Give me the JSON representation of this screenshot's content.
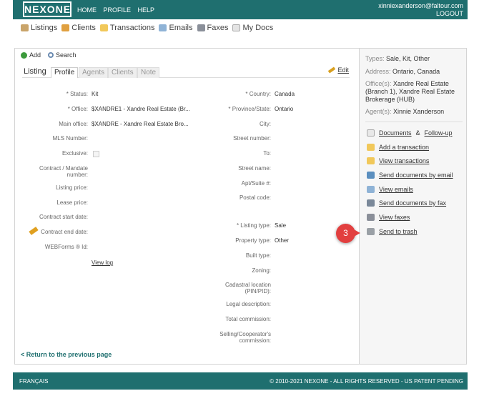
{
  "header": {
    "logo": "NEXONE",
    "nav": [
      "HOME",
      "PROFILE",
      "HELP"
    ],
    "user_email": "xinniexanderson@faltour.com",
    "logout": "LOGOUT"
  },
  "subnav": [
    "Listings",
    "Clients",
    "Transactions",
    "Emails",
    "Faxes",
    "My Docs"
  ],
  "actions": {
    "add": "Add",
    "search": "Search"
  },
  "tabs": {
    "title": "Listing",
    "items": [
      "Profile",
      "Agents",
      "Clients",
      "Note"
    ],
    "edit": "Edit"
  },
  "left_fields": {
    "status": {
      "label": "* Status:",
      "value": "Kit"
    },
    "office": {
      "label": "* Office:",
      "value": "$XANDRE1 - Xandre Real Estate (Br..."
    },
    "main_office": {
      "label": "Main office:",
      "value": "$XANDRE - Xandre Real Estate Bro..."
    },
    "mls": {
      "label": "MLS Number:"
    },
    "exclusive": {
      "label": "Exclusive:"
    },
    "contract": {
      "label": "Contract / Mandate number:"
    },
    "listing_price": {
      "label": "Listing price:"
    },
    "lease_price": {
      "label": "Lease price:"
    },
    "start_date": {
      "label": "Contract start date:"
    },
    "end_date": {
      "label": "Contract end date:"
    },
    "webforms": {
      "label": "WEBForms ® Id:"
    },
    "view_log": "View log"
  },
  "right_fields": {
    "country": {
      "label": "* Country:",
      "value": "Canada"
    },
    "province": {
      "label": "* Province/State:",
      "value": "Ontario"
    },
    "city": {
      "label": "City:"
    },
    "street_number": {
      "label": "Street number:"
    },
    "to": {
      "label": "To:"
    },
    "street_name": {
      "label": "Street name:"
    },
    "apt": {
      "label": "Apt/Suite #:"
    },
    "postal": {
      "label": "Postal code:"
    },
    "listing_type": {
      "label": "* Listing type:",
      "value": "Sale"
    },
    "property_type": {
      "label": "Property type:",
      "value": "Other"
    },
    "built_type": {
      "label": "Built type:"
    },
    "zoning": {
      "label": "Zoning:"
    },
    "cadastral": {
      "label": "Cadastral location (PIN/PID):"
    },
    "legal": {
      "label": "Legal description:"
    },
    "total_commission": {
      "label": "Total commission:"
    },
    "selling_commission": {
      "label": "Selling/Cooperator's commission:"
    }
  },
  "back_link": "< Return to the previous page",
  "info": {
    "types_label": "Types:",
    "types_value": "Sale, Kit, Other",
    "address_label": "Address:",
    "address_value": "Ontario, Canada",
    "offices_label": "Office(s):",
    "offices_value": "Xandre Real Estate (Branch 1), Xandre Real Estate Brokerage (HUB)",
    "agents_label": "Agent(s):",
    "agents_value": "Xinnie Xanderson"
  },
  "sidebar_links": {
    "documents": "Documents",
    "amp": "&",
    "followup": "Follow-up",
    "add_transaction": "Add a transaction",
    "view_transactions": "View transactions",
    "send_email": "Send documents by email",
    "view_emails": "View emails",
    "send_fax": "Send documents by fax",
    "view_faxes": "View faxes",
    "trash": "Send to trash"
  },
  "step_badge": "3",
  "footer": {
    "lang": "FRANÇAIS",
    "copyright": "© 2010-2021 NEXONE - ALL RIGHTS RESERVED - US PATENT PENDING"
  },
  "colors": {
    "brand": "#1f6f6f",
    "badge": "#e23f3f"
  }
}
